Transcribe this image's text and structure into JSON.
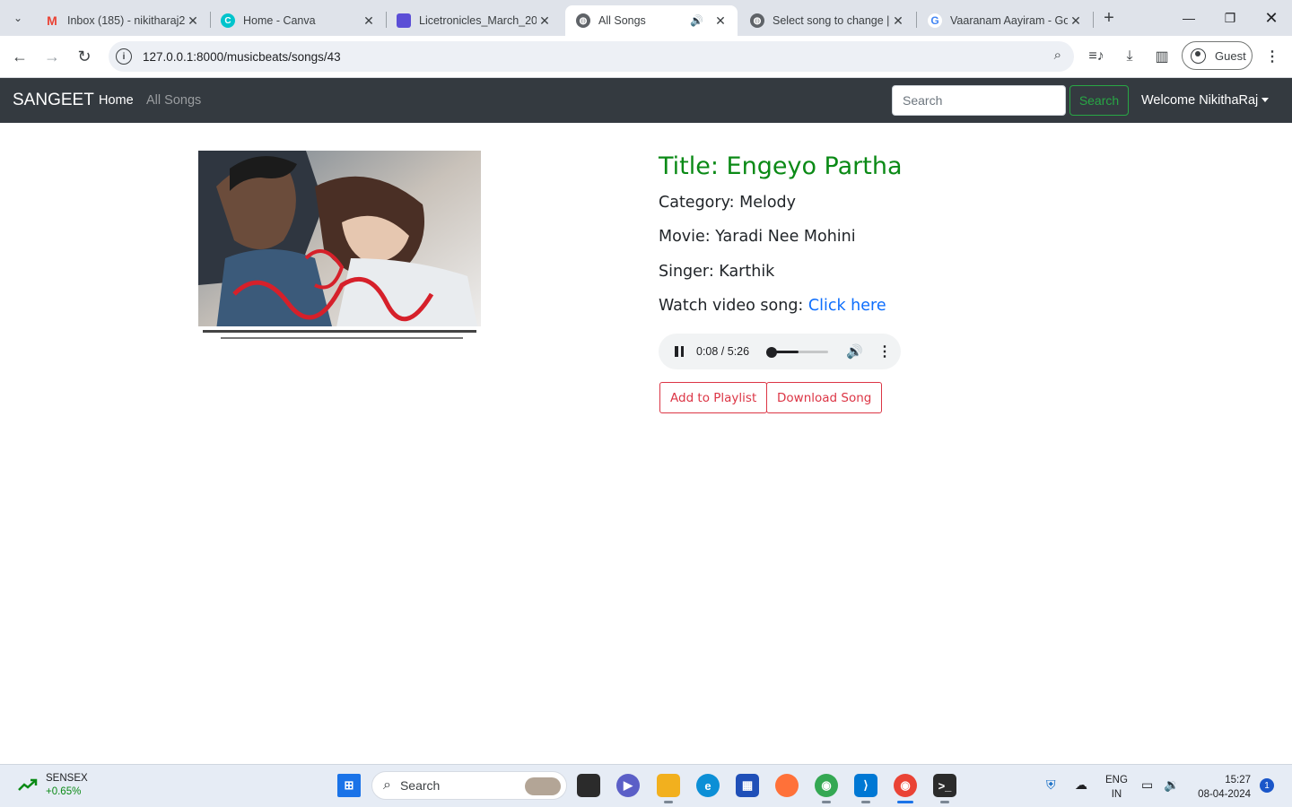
{
  "browser": {
    "tabs": [
      {
        "title": "Inbox (185) - nikitharaj2",
        "favicon": "gmail-icon",
        "color": "#ea4335"
      },
      {
        "title": "Home - Canva",
        "favicon": "canva-icon",
        "color": "#00c4cc"
      },
      {
        "title": "Licetronicles_March_202",
        "favicon": "doc-icon",
        "color": "#5b4ed6"
      },
      {
        "title": "All Songs",
        "favicon": "globe-icon",
        "color": "#5f6368",
        "active": true,
        "playing_audio": true
      },
      {
        "title": "Select song to change | ",
        "favicon": "globe-icon",
        "color": "#5f6368"
      },
      {
        "title": "Vaaranam Aayiram - Go",
        "favicon": "google-icon",
        "color": "#4285f4"
      }
    ],
    "url": "127.0.0.1:8000/musicbeats/songs/43",
    "profile_label": "Guest"
  },
  "navbar": {
    "brand": "SANGEET",
    "links": [
      {
        "label": "Home",
        "active": true
      },
      {
        "label": "All Songs",
        "active": false
      }
    ],
    "search_placeholder": "Search",
    "search_button": "Search",
    "welcome": "Welcome NikithaRaj"
  },
  "song": {
    "title": "Title: Engeyo Partha",
    "category": "Category: Melody",
    "movie": "Movie: Yaradi Nee Mohini",
    "singer": "Singer: Karthik",
    "video_label": "Watch video song: ",
    "video_link": "Click here",
    "player": {
      "time": "0:08 / 5:26",
      "progress_fraction": 0.025,
      "volume_fraction": 0.5
    },
    "buttons": {
      "add_playlist": "Add to Playlist",
      "download": "Download Song"
    }
  },
  "taskbar": {
    "stock_name": "SENSEX",
    "stock_change": "+0.65%",
    "search_placeholder": "Search",
    "lang_top": "ENG",
    "lang_bottom": "IN",
    "time": "15:27",
    "date": "08-04-2024",
    "notification_count": "1"
  },
  "colors": {
    "title_green": "#0b8a16",
    "link_blue": "#0d6efd",
    "danger_red": "#dc3545",
    "navbar_dark": "#343a40",
    "search_green": "#28a745"
  }
}
